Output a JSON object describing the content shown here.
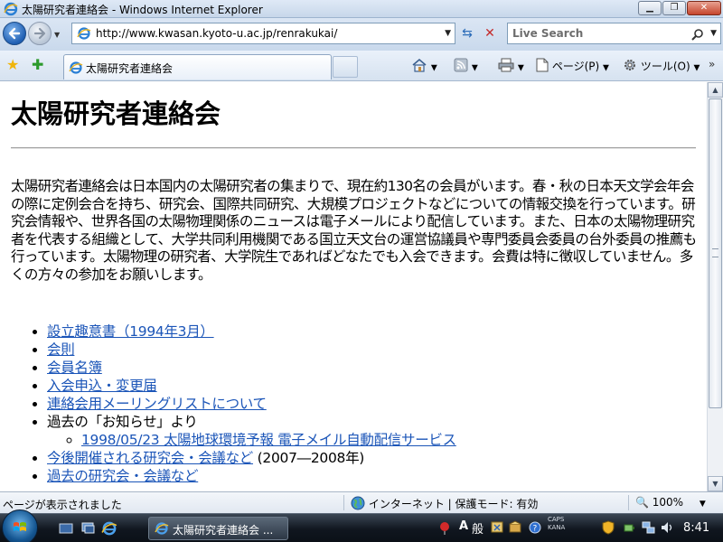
{
  "window": {
    "title": "太陽研究者連絡会 - Windows Internet Explorer",
    "min_glyph": "▁",
    "max_glyph": "❐",
    "close_glyph": "✕"
  },
  "address_bar": {
    "url": "http://www.kwasan.kyoto-u.ac.jp/renrakukai/",
    "dropdown_glyph": "▼"
  },
  "search": {
    "placeholder": "Live Search",
    "dropdown_glyph": "▼"
  },
  "tabs": [
    {
      "label": "太陽研究者連絡会",
      "active": true
    }
  ],
  "command_bar": {
    "page_label": "ページ(P)",
    "tools_label": "ツール(O)",
    "more_glyph": "»",
    "dropdown_glyph": "▼"
  },
  "page": {
    "heading": "太陽研究者連絡会",
    "intro": "太陽研究者連絡会は日本国内の太陽研究者の集まりで、現在約130名の会員がいます。春・秋の日本天文学会年会の際に定例会合を持ち、研究会、国際共同研究、大規模プロジェクトなどについての情報交換を行っています。研究会情報や、世界各国の太陽物理関係のニュースは電子メールにより配信しています。また、日本の太陽物理研究者を代表する組織として、大学共同利用機関である国立天文台の運営協議員や専門委員会委員の台外委員の推薦も行っています。太陽物理の研究者、大学院生であればどなたでも入会できます。会費は特に徴収していません。多くの方々の参加をお願いします。",
    "links": [
      {
        "label": "設立趣意書（1994年3月）"
      },
      {
        "label": "会則"
      },
      {
        "label": "会員名簿"
      },
      {
        "label": "入会申込・変更届"
      },
      {
        "label": "連絡会用メーリングリストについて"
      }
    ],
    "news_item": {
      "label": "過去の「お知らせ」より",
      "sub_link": "1998/05/23 太陽地球環境予報 電子メイル自動配信サービス"
    },
    "upcoming": {
      "link": "今後開催される研究会・会議など",
      "suffix": "(2007―2008年)"
    },
    "past_link": "過去の研究会・会議など"
  },
  "status_bar": {
    "status_text": "ページが表示されました",
    "zone_text": "インターネット | 保護モード: 有効",
    "zoom_text": "100%"
  },
  "taskbar": {
    "task_label": "太陽研究者連絡会 ...",
    "ime_a": "A",
    "ime_han": "般",
    "caps": "CAPS",
    "kana": "KANA",
    "clock": "8:41"
  },
  "colors": {
    "link": "#1b55b8",
    "title_bar": "#c7d7ea",
    "taskbar": "#10161f"
  },
  "icons": {
    "back": "back-arrow-icon",
    "forward": "forward-arrow-icon",
    "favorites": "star-icon",
    "add_favorites": "add-favorite-icon",
    "home": "home-icon",
    "feeds": "rss-icon",
    "print": "printer-icon",
    "page": "page-icon",
    "tools": "gear-icon"
  }
}
